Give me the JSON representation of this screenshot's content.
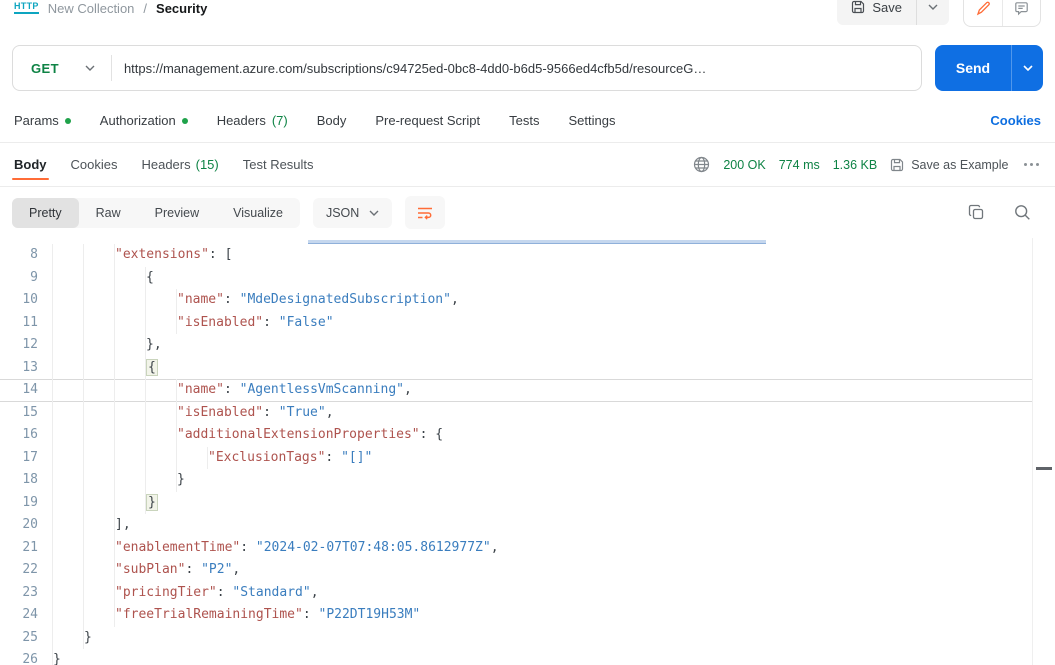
{
  "header": {
    "http_badge": "HTTP",
    "collection": "New Collection",
    "separator": "/",
    "request_name": "Security",
    "save_label": "Save"
  },
  "request": {
    "method": "GET",
    "url": "https://management.azure.com/subscriptions/c94725ed-0bc8-4dd0-b6d5-9566ed4cfb5d/resourceG…",
    "send_label": "Send"
  },
  "request_tabs": {
    "params": "Params",
    "authorization": "Authorization",
    "headers": "Headers",
    "headers_count": "(7)",
    "body": "Body",
    "prerequest": "Pre-request Script",
    "tests": "Tests",
    "settings": "Settings",
    "cookies_link": "Cookies"
  },
  "response": {
    "tabs": {
      "body": "Body",
      "cookies": "Cookies",
      "headers": "Headers",
      "headers_count": "(15)",
      "test_results": "Test Results"
    },
    "meta": {
      "status": "200 OK",
      "time": "774 ms",
      "size": "1.36 KB",
      "save_as_example": "Save as Example"
    }
  },
  "toolbar": {
    "views": [
      "Pretty",
      "Raw",
      "Preview",
      "Visualize"
    ],
    "active_view": "Pretty",
    "language": "JSON"
  },
  "colors": {
    "accent_orange": "#ff6c37",
    "send_blue": "#0f6fe3",
    "link_blue": "#0d6ee0",
    "method_green": "#0e8345",
    "dot_green": "#1fa24a",
    "json_key": "#ae534e",
    "json_string": "#3a7dbe",
    "line_number": "#7e95a9",
    "http_badge_teal": "#0da5c0"
  },
  "code": {
    "lines": [
      {
        "n": 8,
        "i": 2,
        "t": [
          [
            "k",
            "\"extensions\""
          ],
          [
            "p",
            ": ["
          ]
        ]
      },
      {
        "n": 9,
        "i": 3,
        "t": [
          [
            "p",
            "{"
          ]
        ]
      },
      {
        "n": 10,
        "i": 4,
        "t": [
          [
            "k",
            "\"name\""
          ],
          [
            "p",
            ": "
          ],
          [
            "s",
            "\"MdeDesignatedSubscription\""
          ],
          [
            "p",
            ","
          ]
        ]
      },
      {
        "n": 11,
        "i": 4,
        "t": [
          [
            "k",
            "\"isEnabled\""
          ],
          [
            "p",
            ": "
          ],
          [
            "s",
            "\"False\""
          ]
        ]
      },
      {
        "n": 12,
        "i": 3,
        "t": [
          [
            "p",
            "},"
          ]
        ]
      },
      {
        "n": 13,
        "i": 3,
        "t": [
          [
            "b",
            "{"
          ]
        ]
      },
      {
        "n": 14,
        "i": 4,
        "current": true,
        "t": [
          [
            "k",
            "\"name\""
          ],
          [
            "p",
            ": "
          ],
          [
            "s",
            "\"AgentlessVmScanning\""
          ],
          [
            "p",
            ","
          ]
        ]
      },
      {
        "n": 15,
        "i": 4,
        "t": [
          [
            "k",
            "\"isEnabled\""
          ],
          [
            "p",
            ": "
          ],
          [
            "s",
            "\"True\""
          ],
          [
            "p",
            ","
          ]
        ]
      },
      {
        "n": 16,
        "i": 4,
        "t": [
          [
            "k",
            "\"additionalExtensionProperties\""
          ],
          [
            "p",
            ": {"
          ]
        ]
      },
      {
        "n": 17,
        "i": 5,
        "t": [
          [
            "k",
            "\"ExclusionTags\""
          ],
          [
            "p",
            ": "
          ],
          [
            "s",
            "\"[]\""
          ]
        ]
      },
      {
        "n": 18,
        "i": 4,
        "t": [
          [
            "p",
            "}"
          ]
        ]
      },
      {
        "n": 19,
        "i": 3,
        "t": [
          [
            "b",
            "}"
          ]
        ]
      },
      {
        "n": 20,
        "i": 2,
        "t": [
          [
            "p",
            "],"
          ]
        ]
      },
      {
        "n": 21,
        "i": 2,
        "t": [
          [
            "k",
            "\"enablementTime\""
          ],
          [
            "p",
            ": "
          ],
          [
            "s",
            "\"2024-02-07T07:48:05.8612977Z\""
          ],
          [
            "p",
            ","
          ]
        ]
      },
      {
        "n": 22,
        "i": 2,
        "t": [
          [
            "k",
            "\"subPlan\""
          ],
          [
            "p",
            ": "
          ],
          [
            "s",
            "\"P2\""
          ],
          [
            "p",
            ","
          ]
        ]
      },
      {
        "n": 23,
        "i": 2,
        "t": [
          [
            "k",
            "\"pricingTier\""
          ],
          [
            "p",
            ": "
          ],
          [
            "s",
            "\"Standard\""
          ],
          [
            "p",
            ","
          ]
        ]
      },
      {
        "n": 24,
        "i": 2,
        "t": [
          [
            "k",
            "\"freeTrialRemainingTime\""
          ],
          [
            "p",
            ": "
          ],
          [
            "s",
            "\"P22DT19H53M\""
          ]
        ]
      },
      {
        "n": 25,
        "i": 1,
        "t": [
          [
            "p",
            "}"
          ]
        ]
      },
      {
        "n": 26,
        "i": 0,
        "t": [
          [
            "p",
            "}"
          ]
        ]
      }
    ]
  }
}
